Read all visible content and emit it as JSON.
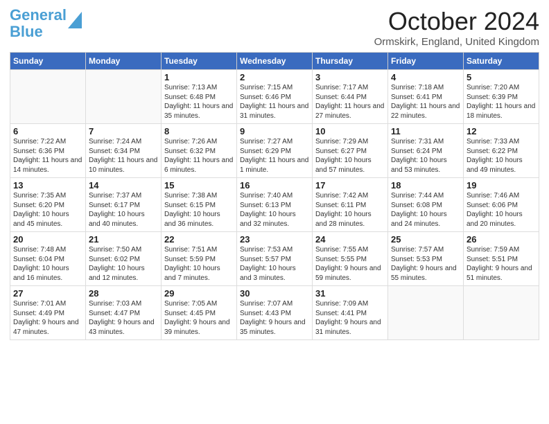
{
  "header": {
    "logo_line1": "General",
    "logo_line2": "Blue",
    "month_title": "October 2024",
    "location": "Ormskirk, England, United Kingdom"
  },
  "days_of_week": [
    "Sunday",
    "Monday",
    "Tuesday",
    "Wednesday",
    "Thursday",
    "Friday",
    "Saturday"
  ],
  "weeks": [
    [
      {
        "day": "",
        "content": ""
      },
      {
        "day": "",
        "content": ""
      },
      {
        "day": "1",
        "content": "Sunrise: 7:13 AM\nSunset: 6:48 PM\nDaylight: 11 hours and 35 minutes."
      },
      {
        "day": "2",
        "content": "Sunrise: 7:15 AM\nSunset: 6:46 PM\nDaylight: 11 hours and 31 minutes."
      },
      {
        "day": "3",
        "content": "Sunrise: 7:17 AM\nSunset: 6:44 PM\nDaylight: 11 hours and 27 minutes."
      },
      {
        "day": "4",
        "content": "Sunrise: 7:18 AM\nSunset: 6:41 PM\nDaylight: 11 hours and 22 minutes."
      },
      {
        "day": "5",
        "content": "Sunrise: 7:20 AM\nSunset: 6:39 PM\nDaylight: 11 hours and 18 minutes."
      }
    ],
    [
      {
        "day": "6",
        "content": "Sunrise: 7:22 AM\nSunset: 6:36 PM\nDaylight: 11 hours and 14 minutes."
      },
      {
        "day": "7",
        "content": "Sunrise: 7:24 AM\nSunset: 6:34 PM\nDaylight: 11 hours and 10 minutes."
      },
      {
        "day": "8",
        "content": "Sunrise: 7:26 AM\nSunset: 6:32 PM\nDaylight: 11 hours and 6 minutes."
      },
      {
        "day": "9",
        "content": "Sunrise: 7:27 AM\nSunset: 6:29 PM\nDaylight: 11 hours and 1 minute."
      },
      {
        "day": "10",
        "content": "Sunrise: 7:29 AM\nSunset: 6:27 PM\nDaylight: 10 hours and 57 minutes."
      },
      {
        "day": "11",
        "content": "Sunrise: 7:31 AM\nSunset: 6:24 PM\nDaylight: 10 hours and 53 minutes."
      },
      {
        "day": "12",
        "content": "Sunrise: 7:33 AM\nSunset: 6:22 PM\nDaylight: 10 hours and 49 minutes."
      }
    ],
    [
      {
        "day": "13",
        "content": "Sunrise: 7:35 AM\nSunset: 6:20 PM\nDaylight: 10 hours and 45 minutes."
      },
      {
        "day": "14",
        "content": "Sunrise: 7:37 AM\nSunset: 6:17 PM\nDaylight: 10 hours and 40 minutes."
      },
      {
        "day": "15",
        "content": "Sunrise: 7:38 AM\nSunset: 6:15 PM\nDaylight: 10 hours and 36 minutes."
      },
      {
        "day": "16",
        "content": "Sunrise: 7:40 AM\nSunset: 6:13 PM\nDaylight: 10 hours and 32 minutes."
      },
      {
        "day": "17",
        "content": "Sunrise: 7:42 AM\nSunset: 6:11 PM\nDaylight: 10 hours and 28 minutes."
      },
      {
        "day": "18",
        "content": "Sunrise: 7:44 AM\nSunset: 6:08 PM\nDaylight: 10 hours and 24 minutes."
      },
      {
        "day": "19",
        "content": "Sunrise: 7:46 AM\nSunset: 6:06 PM\nDaylight: 10 hours and 20 minutes."
      }
    ],
    [
      {
        "day": "20",
        "content": "Sunrise: 7:48 AM\nSunset: 6:04 PM\nDaylight: 10 hours and 16 minutes."
      },
      {
        "day": "21",
        "content": "Sunrise: 7:50 AM\nSunset: 6:02 PM\nDaylight: 10 hours and 12 minutes."
      },
      {
        "day": "22",
        "content": "Sunrise: 7:51 AM\nSunset: 5:59 PM\nDaylight: 10 hours and 7 minutes."
      },
      {
        "day": "23",
        "content": "Sunrise: 7:53 AM\nSunset: 5:57 PM\nDaylight: 10 hours and 3 minutes."
      },
      {
        "day": "24",
        "content": "Sunrise: 7:55 AM\nSunset: 5:55 PM\nDaylight: 9 hours and 59 minutes."
      },
      {
        "day": "25",
        "content": "Sunrise: 7:57 AM\nSunset: 5:53 PM\nDaylight: 9 hours and 55 minutes."
      },
      {
        "day": "26",
        "content": "Sunrise: 7:59 AM\nSunset: 5:51 PM\nDaylight: 9 hours and 51 minutes."
      }
    ],
    [
      {
        "day": "27",
        "content": "Sunrise: 7:01 AM\nSunset: 4:49 PM\nDaylight: 9 hours and 47 minutes."
      },
      {
        "day": "28",
        "content": "Sunrise: 7:03 AM\nSunset: 4:47 PM\nDaylight: 9 hours and 43 minutes."
      },
      {
        "day": "29",
        "content": "Sunrise: 7:05 AM\nSunset: 4:45 PM\nDaylight: 9 hours and 39 minutes."
      },
      {
        "day": "30",
        "content": "Sunrise: 7:07 AM\nSunset: 4:43 PM\nDaylight: 9 hours and 35 minutes."
      },
      {
        "day": "31",
        "content": "Sunrise: 7:09 AM\nSunset: 4:41 PM\nDaylight: 9 hours and 31 minutes."
      },
      {
        "day": "",
        "content": ""
      },
      {
        "day": "",
        "content": ""
      }
    ]
  ]
}
